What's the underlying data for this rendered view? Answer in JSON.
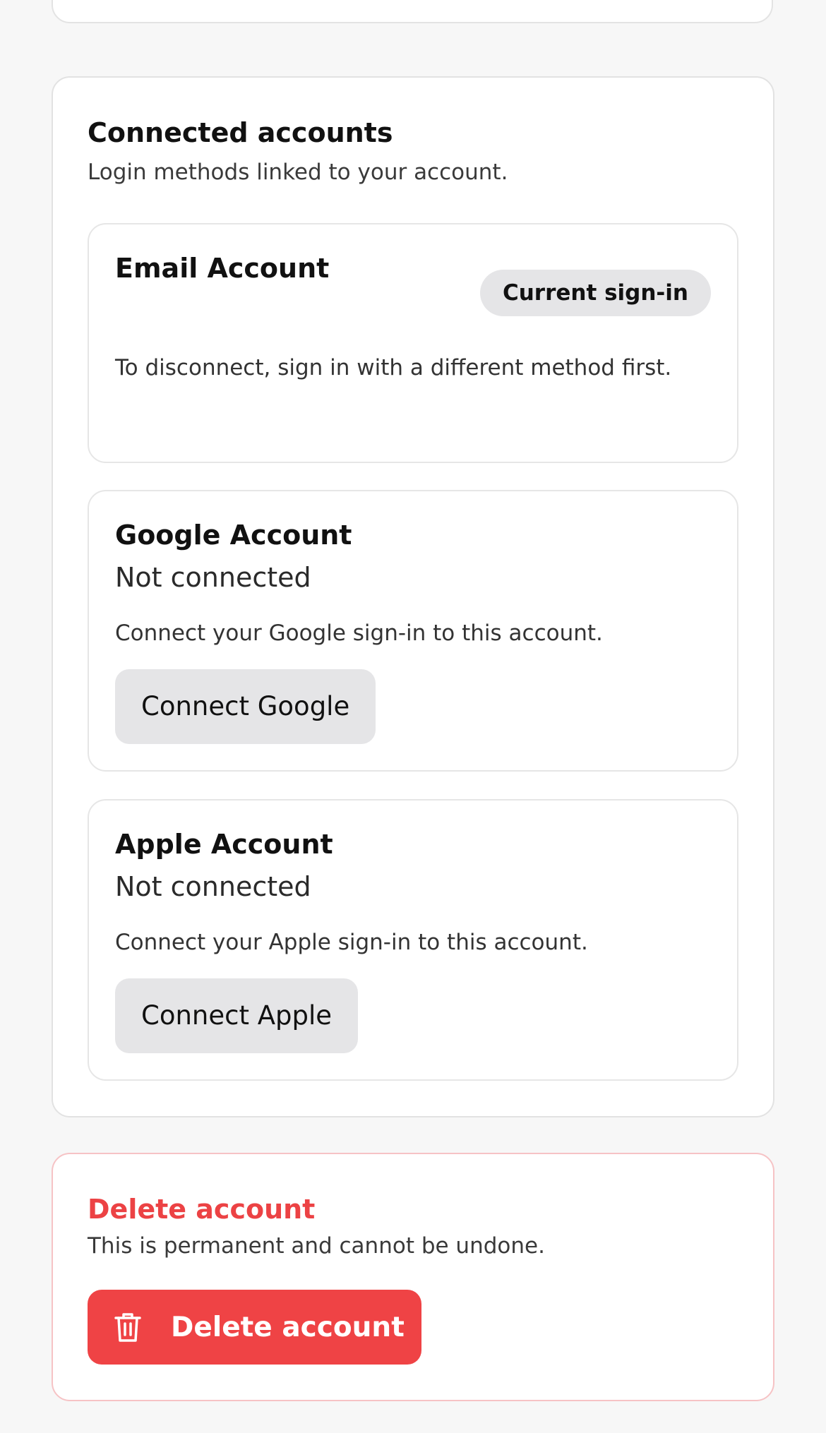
{
  "connected_accounts": {
    "title": "Connected accounts",
    "subtitle": "Login methods linked to your account.",
    "email": {
      "title": "Email Account",
      "badge": "Current sign-in",
      "description": "To disconnect, sign in with a different method first."
    },
    "google": {
      "title": "Google Account",
      "status": "Not connected",
      "description": "Connect your Google sign-in to this account.",
      "button_label": "Connect Google"
    },
    "apple": {
      "title": "Apple Account",
      "status": "Not connected",
      "description": "Connect your Apple sign-in to this account.",
      "button_label": "Connect Apple"
    }
  },
  "danger_zone": {
    "title": "Delete account",
    "subtitle": "This is permanent and cannot be undone.",
    "button_label": "Delete account",
    "button_icon": "trash-icon",
    "accent_color": "#ef4345"
  }
}
